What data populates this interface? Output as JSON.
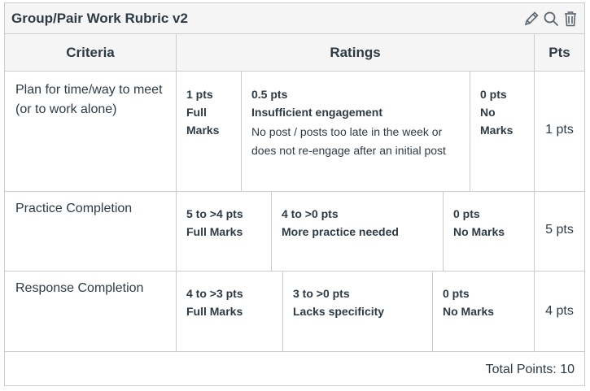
{
  "title": "Group/Pair Work Rubric v2",
  "toolbar": {
    "edit_icon": "pencil-icon",
    "search_icon": "magnifier-icon",
    "delete_icon": "trash-icon"
  },
  "headers": {
    "criteria": "Criteria",
    "ratings": "Ratings",
    "pts": "Pts"
  },
  "rows": [
    {
      "criterion": "Plan for time/way to meet (or to work alone)",
      "ratings": [
        {
          "points": "1 pts",
          "title": "Full Marks",
          "description": ""
        },
        {
          "points": "0.5 pts",
          "title": "Insufficient engagement",
          "description": "No post / posts too late in the week or does not re-engage after an initial post"
        },
        {
          "points": "0 pts",
          "title": "No Marks",
          "description": ""
        }
      ],
      "pts": "1 pts"
    },
    {
      "criterion": "Practice Completion",
      "ratings": [
        {
          "points": "5 to >4 pts",
          "title": "Full Marks",
          "description": ""
        },
        {
          "points": "4 to >0 pts",
          "title": "More practice needed",
          "description": ""
        },
        {
          "points": "0 pts",
          "title": "No Marks",
          "description": ""
        }
      ],
      "pts": "5 pts"
    },
    {
      "criterion": "Response Completion",
      "ratings": [
        {
          "points": "4 to >3 pts",
          "title": "Full Marks",
          "description": ""
        },
        {
          "points": "3 to >0 pts",
          "title": "Lacks specificity",
          "description": ""
        },
        {
          "points": "0 pts",
          "title": "No Marks",
          "description": ""
        }
      ],
      "pts": "4 pts"
    }
  ],
  "total": "Total Points: 10"
}
